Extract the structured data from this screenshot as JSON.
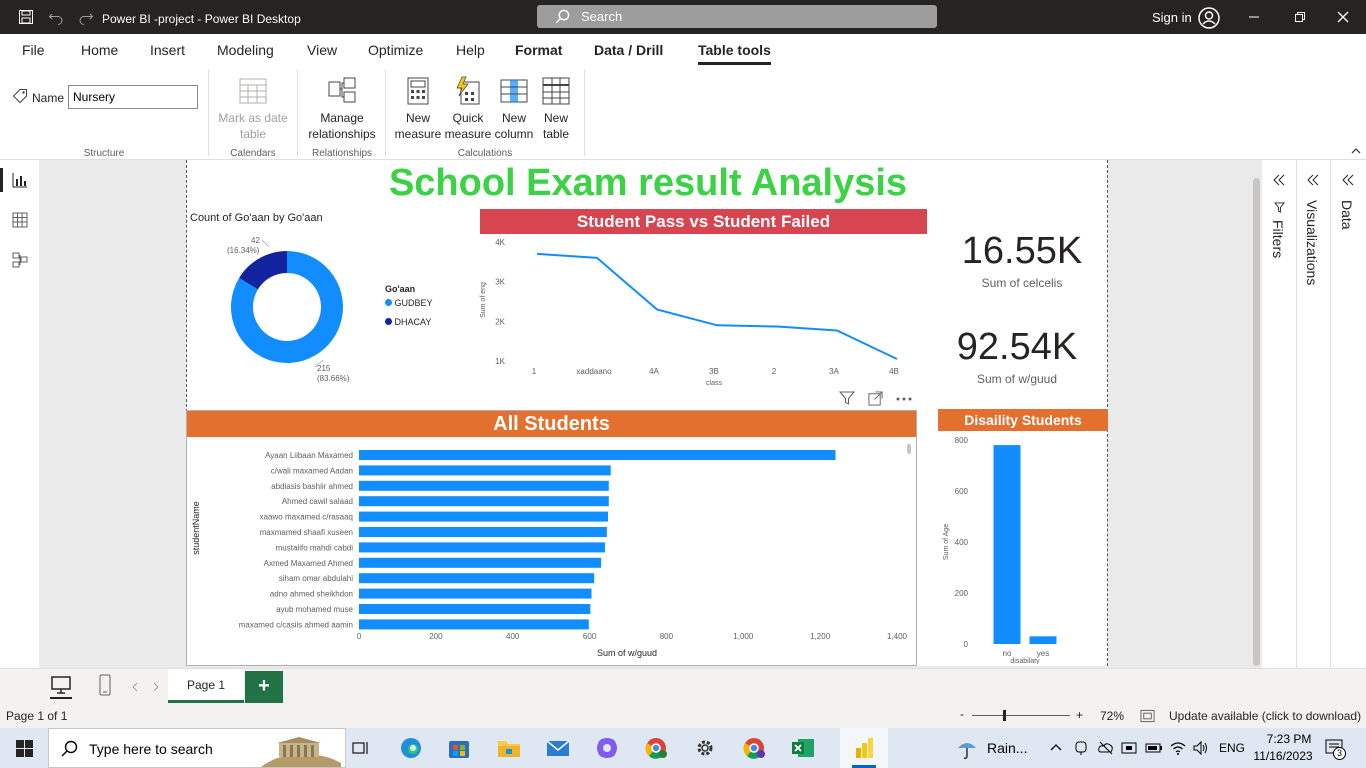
{
  "window": {
    "title": "Power BI -project - Power BI Desktop",
    "search_placeholder": "Search",
    "sign_in": "Sign in"
  },
  "ribbon_tabs": [
    "File",
    "Home",
    "Insert",
    "Modeling",
    "View",
    "Optimize",
    "Help",
    "Format",
    "Data / Drill",
    "Table tools"
  ],
  "active_tab": "Table tools",
  "ribbon": {
    "name_label": "Name",
    "name_value": "Nursery",
    "groups": {
      "structure": "Structure",
      "calendars": "Calendars",
      "relationships": "Relationships",
      "calculations": "Calculations"
    },
    "buttons": {
      "mark_date_1": "Mark as date",
      "mark_date_2": "table",
      "manage_rel_1": "Manage",
      "manage_rel_2": "relationships",
      "new_measure_1": "New",
      "new_measure_2": "measure",
      "quick_measure_1": "Quick",
      "quick_measure_2": "measure",
      "new_column_1": "New",
      "new_column_2": "column",
      "new_table_1": "New",
      "new_table_2": "table"
    }
  },
  "report": {
    "title": "School Exam result Analysis",
    "donut_title": "Count of Go'aan by Go'aan",
    "legend_title": "Go'aan",
    "kpi1_value": "16.55K",
    "kpi1_label": "Sum of celcelis",
    "kpi2_value": "92.54K",
    "kpi2_label": "Sum of w/guud",
    "line_title": "Student Pass vs Student Failed",
    "bar_title": "All Students",
    "dis_title": "Disaility Students"
  },
  "chart_data": [
    {
      "type": "pie",
      "title": "Count of Go'aan by Go'aan",
      "legend_title": "Go'aan",
      "categories": [
        "GUDBEY",
        "DHACAY"
      ],
      "values": [
        215,
        42
      ],
      "labels": [
        "215",
        "42"
      ],
      "percent_labels": [
        "(83.66%)",
        "(16.34%)"
      ],
      "colors": [
        "#118DFF",
        "#12239E"
      ]
    },
    {
      "type": "line",
      "title": "Student Pass vs Student Failed",
      "categories": [
        "1",
        "xaddaano",
        "4A",
        "3B",
        "2",
        "3A",
        "4B"
      ],
      "values": [
        3700,
        3600,
        2300,
        1900,
        1870,
        1770,
        1050
      ],
      "xlabel": "class",
      "ylabel": "Sum of eng",
      "ylim": [
        1000,
        4000
      ],
      "yticks": [
        "1K",
        "2K",
        "3K",
        "4K"
      ],
      "color": "#118DFF"
    },
    {
      "type": "bar",
      "orientation": "horizontal",
      "title": "All Students",
      "categories": [
        "Ayaan Liibaan Maxamed",
        "c/wali maxamed Aadan",
        "abdiasis bashiir ahmed",
        "Ahmed cawil salaad",
        "xaawo maxamed c/rasaaq",
        "maxmamed shaafi xuseen",
        "mustalifo mahdi cabdi",
        "Axmed Maxamed Ahmed",
        "siham omar abdulahi",
        "adno ahmed sheikhdon",
        "ayub mohamed muse",
        "maxamed c/casiis ahmed aamin"
      ],
      "values": [
        1240,
        655,
        650,
        650,
        648,
        645,
        640,
        630,
        612,
        605,
        602,
        598
      ],
      "xlabel": "Sum of w/guud",
      "ylabel": "studentName",
      "xlim": [
        0,
        1400
      ],
      "xticks": [
        "0",
        "200",
        "400",
        "600",
        "800",
        "1,000",
        "1,200",
        "1,400"
      ],
      "color": "#118DFF"
    },
    {
      "type": "bar",
      "title": "Disaility Students",
      "categories": [
        "no",
        "yes"
      ],
      "values": [
        780,
        30
      ],
      "xlabel": "disabilaty",
      "ylabel": "Sum of Age",
      "ylim": [
        0,
        800
      ],
      "yticks": [
        "0",
        "200",
        "400",
        "600",
        "800"
      ],
      "color": "#118DFF"
    }
  ],
  "pages": {
    "current": "Page 1",
    "add": "+"
  },
  "status": {
    "page": "Page 1 of 1",
    "zoom": "72%",
    "update": "Update available (click to download)",
    "minus": "-",
    "plus": "+"
  },
  "panes": {
    "filters": "Filters",
    "visualizations": "Visualizations",
    "data": "Data"
  },
  "taskbar": {
    "search_placeholder": "Type here to search",
    "weather": "Rain...",
    "lang": "ENG",
    "time": "7:23 PM",
    "date": "11/16/2023",
    "notif": "3"
  }
}
